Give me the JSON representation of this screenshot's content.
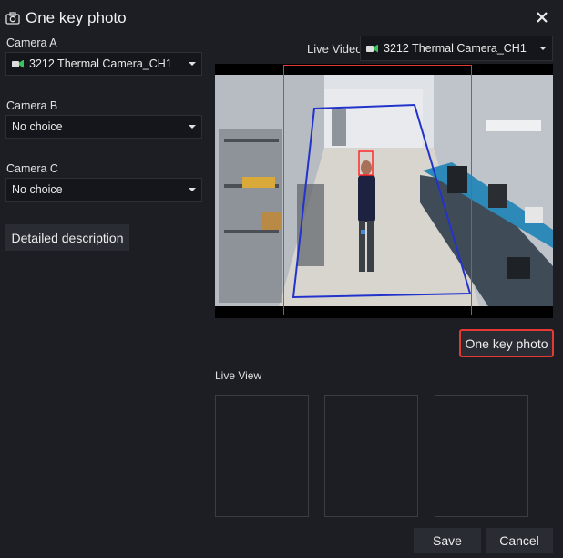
{
  "dialog": {
    "title": "One key photo",
    "close_icon": "close-icon",
    "camera_icon": "camera-icon"
  },
  "left": {
    "camera_a": {
      "label": "Camera A",
      "value": "3212 Thermal Camera_CH1",
      "icon": "camera-device-icon"
    },
    "camera_b": {
      "label": "Camera B",
      "value": "No choice"
    },
    "camera_c": {
      "label": "Camera C",
      "value": "No choice"
    },
    "detail_button": "Detailed description"
  },
  "live_video": {
    "label": "Live Video",
    "value": "3212 Thermal Camera_CH1",
    "icon": "camera-device-icon"
  },
  "one_key_button": "One key photo",
  "live_view": {
    "label": "Live View"
  },
  "footer": {
    "save": "Save",
    "cancel": "Cancel"
  },
  "colors": {
    "background": "#1c1e24",
    "field": "#15161b",
    "button": "#2a2c33",
    "highlight": "#e53935",
    "detection_line": "#2233cc",
    "face_box": "#ff2a2a"
  }
}
